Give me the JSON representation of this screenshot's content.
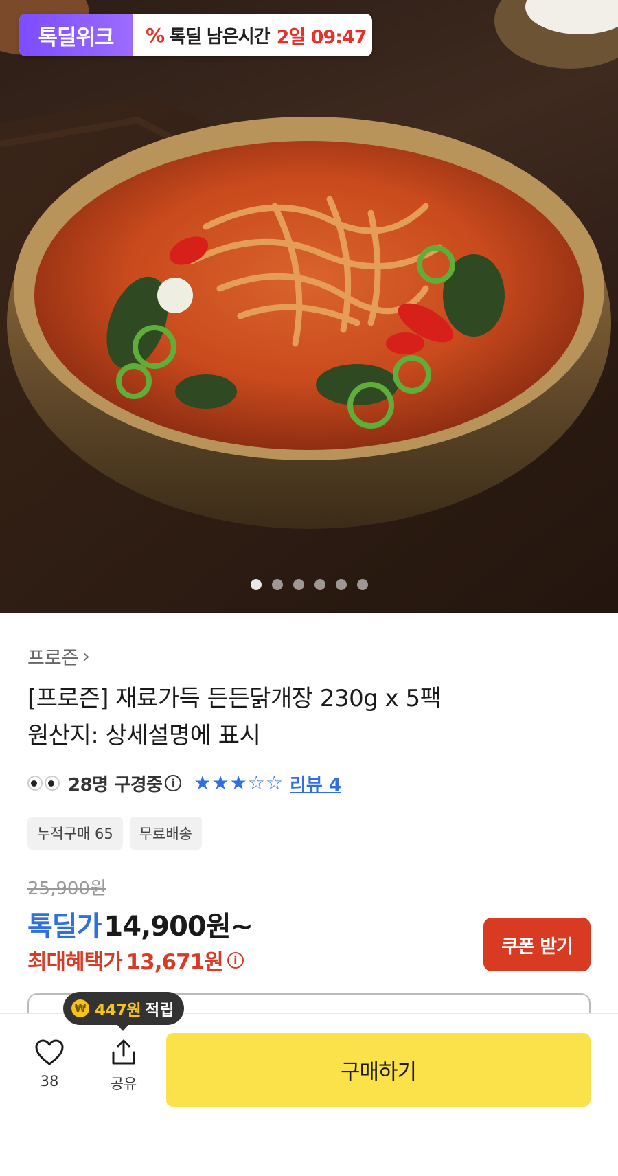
{
  "deal_banner": {
    "logo": "톡딜위크",
    "pct_icon": "percent-icon",
    "label": "톡딜 남은시간",
    "remaining": "2일 09:47"
  },
  "carousel": {
    "total": 6,
    "active_index": 0
  },
  "product": {
    "category": "프로즌",
    "title_line1": "[프로즌] 재료가득 든든닭개장 230g x 5팩",
    "title_line2": "원산지: 상세설명에 표시",
    "viewers": "28명 구경중",
    "rating": 3,
    "rating_max": 5,
    "review_link": "리뷰 4",
    "badges": [
      "누적구매 65",
      "무료배송"
    ]
  },
  "pricing": {
    "original": "25,900원",
    "sale_label": "톡딜가",
    "sale_price": "14,900원~",
    "max_label": "최대혜택가",
    "max_price": "13,671원",
    "coupon_button": "쿠폰 받기"
  },
  "points": {
    "coin_symbol": "₩",
    "amount": "447원",
    "suffix": "적립"
  },
  "bottom_bar": {
    "like_count": "38",
    "share_label": "공유",
    "buy_button": "구매하기"
  },
  "colors": {
    "accent_blue": "#2f6fe0",
    "accent_red": "#d63b25",
    "buy_yellow": "#fbe14a",
    "deal_purple": "#7b4dff"
  }
}
